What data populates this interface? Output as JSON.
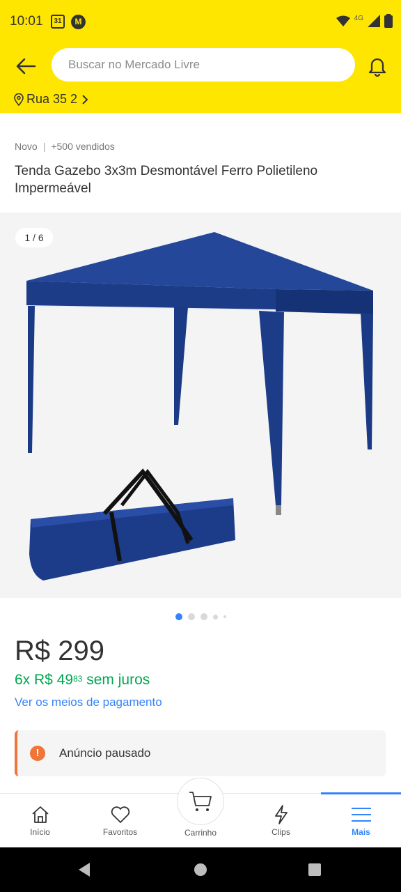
{
  "status_bar": {
    "time": "10:01",
    "calendar_day": "31",
    "network": "4G"
  },
  "header": {
    "search_placeholder": "Buscar no Mercado Livre",
    "location": "Rua 35 2"
  },
  "product": {
    "condition": "Novo",
    "sold": "+500 vendidos",
    "title": "Tenda Gazebo 3x3m Desmontável Ferro Polietileno Impermeável",
    "image_counter": "1 / 6",
    "price": "R$ 299",
    "installments_prefix": "6x R$ 49",
    "installments_cents": "83",
    "installments_suffix": " sem juros",
    "payment_link": "Ver os meios de pagamento"
  },
  "notice": {
    "text": "Anúncio pausado"
  },
  "bottom_nav": {
    "items": [
      {
        "label": "Início",
        "icon": "home-icon"
      },
      {
        "label": "Favoritos",
        "icon": "heart-icon"
      },
      {
        "label": "Carrinho",
        "icon": "cart-icon"
      },
      {
        "label": "Clips",
        "icon": "bolt-icon"
      },
      {
        "label": "Mais",
        "icon": "menu-icon",
        "active": true
      }
    ]
  },
  "colors": {
    "brand_yellow": "#ffe600",
    "link_blue": "#3483fa",
    "green": "#00a650",
    "warning_orange": "#f07539",
    "tent_blue": "#1f3f8f"
  }
}
